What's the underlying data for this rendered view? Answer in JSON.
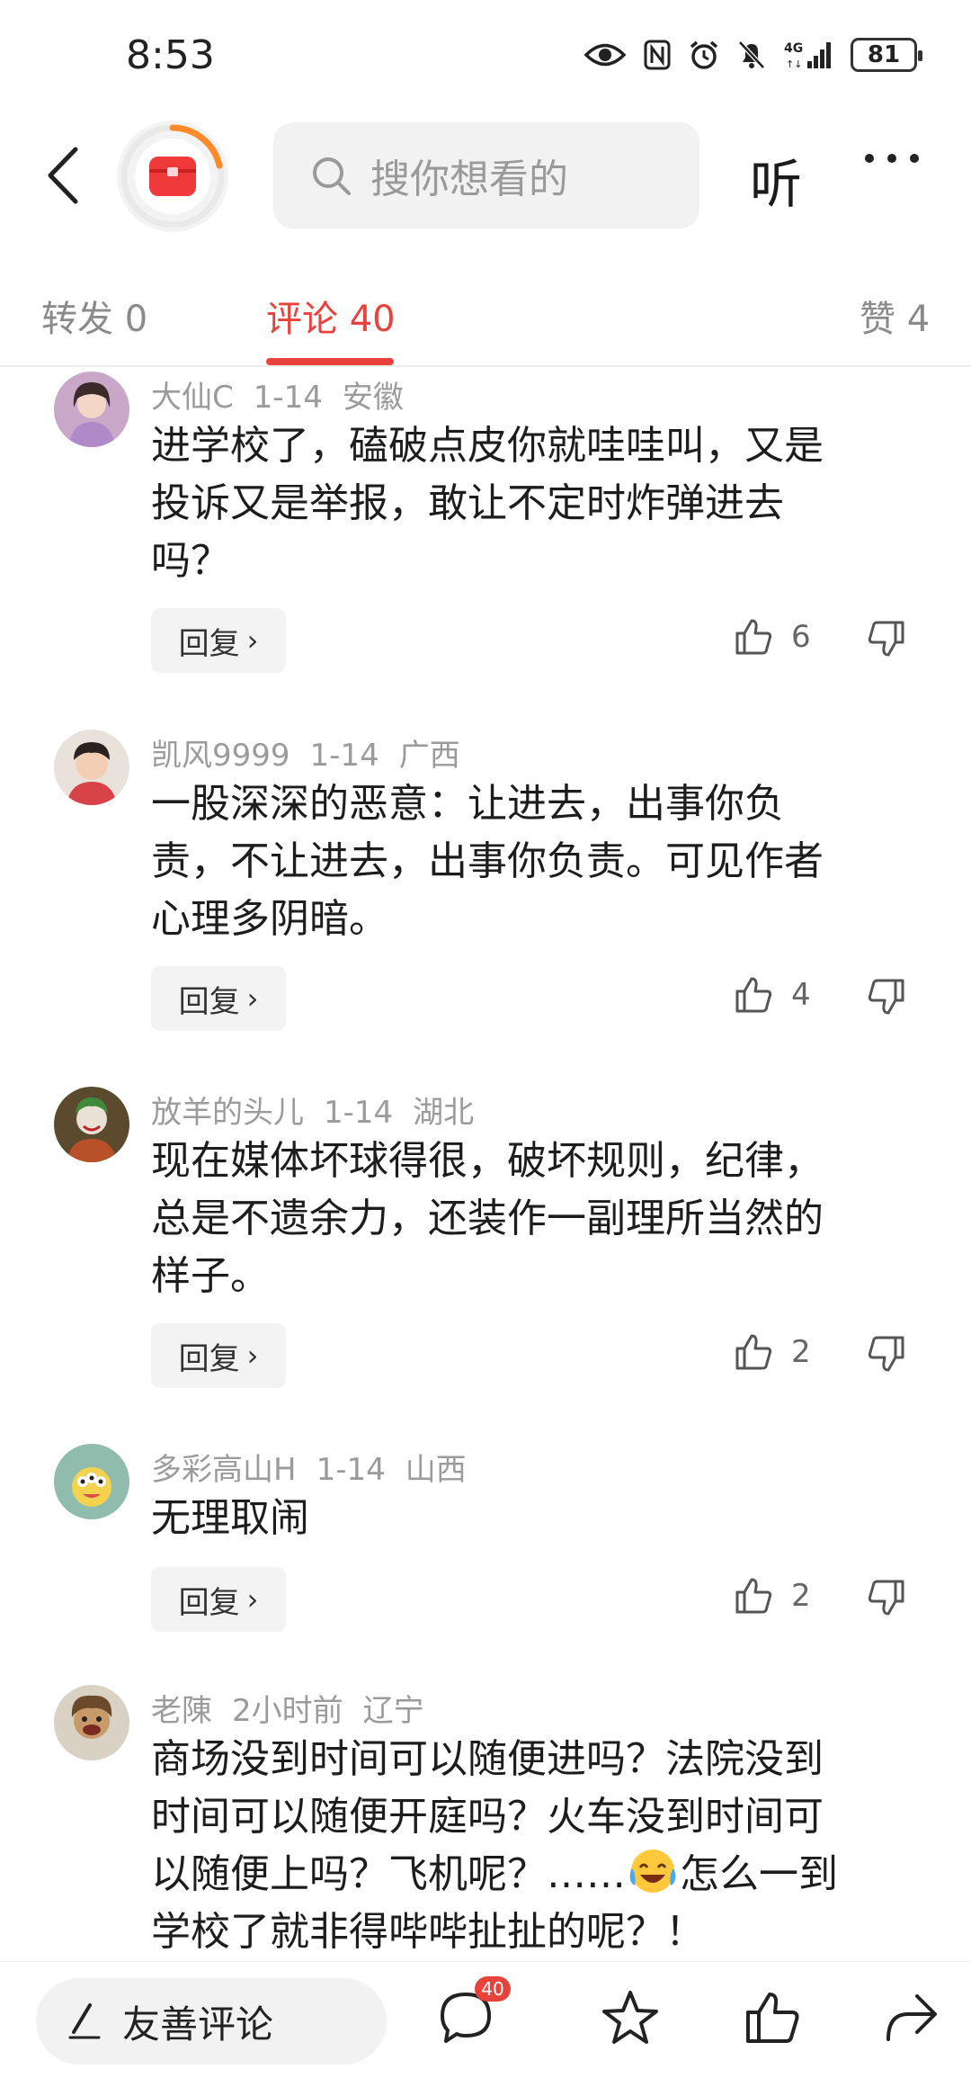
{
  "status_bar": {
    "time": "8:53",
    "network": "4G",
    "battery": "81"
  },
  "header": {
    "search_placeholder": "搜你想看的",
    "listen_label": "听"
  },
  "tabs": [
    {
      "label": "转发 0"
    },
    {
      "label": "评论 40"
    },
    {
      "label": "赞 4"
    }
  ],
  "comments": [
    {
      "user": "大仙C",
      "date": "1-14",
      "region": "安徽",
      "lines": [
        "进学校了，磕破点皮你就哇哇叫，又是",
        "投诉又是举报，敢让不定时炸弹进去",
        "吗？"
      ],
      "likes": "6"
    },
    {
      "user": "凯风9999",
      "date": "1-14",
      "region": "广西",
      "lines": [
        "一股深深的恶意：让进去，出事你负",
        "责，不让进去，出事你负责。可见作者",
        "心理多阴暗。"
      ],
      "likes": "4"
    },
    {
      "user": "放羊的头儿",
      "date": "1-14",
      "region": "湖北",
      "lines": [
        "现在媒体坏球得很，破坏规则，纪律，",
        "总是不遗余力，还装作一副理所当然的",
        "样子。"
      ],
      "likes": "2"
    },
    {
      "user": "多彩高山H",
      "date": "1-14",
      "region": "山西",
      "lines": [
        "无理取闹"
      ],
      "likes": "2"
    },
    {
      "user": "老陳",
      "date": "2小时前",
      "region": "辽宁",
      "lines": [
        "商场没到时间可以随便进吗？法院没到",
        "时间可以随便开庭吗？火车没到时间可",
        "以随便上吗？飞机呢？……",
        "学校了就非得哔哔扯扯的呢？！"
      ],
      "line3_tail": "怎么一到"
    }
  ],
  "reply_label": "回复",
  "bottom_bar": {
    "comment_placeholder": "友善评论",
    "comment_count": "40"
  },
  "colors": {
    "accent": "#e9423c",
    "meta": "#9b9b9b"
  }
}
